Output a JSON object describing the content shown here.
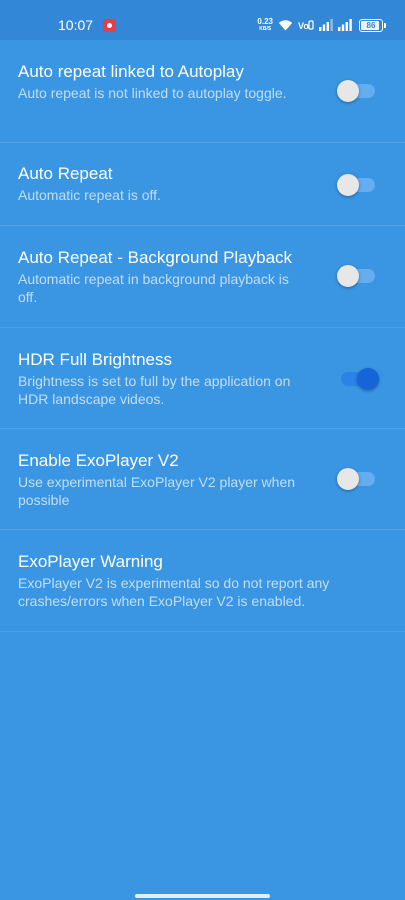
{
  "status_bar": {
    "time": "10:07",
    "net_speed": "0.23",
    "net_unit": "KB/S",
    "battery": "86"
  },
  "settings": [
    {
      "title": "Auto repeat linked to Autoplay",
      "summary": "Auto repeat is not linked to autoplay toggle.",
      "toggle": false
    },
    {
      "title": "Auto Repeat",
      "summary": "Automatic repeat is off.",
      "toggle": false
    },
    {
      "title": "Auto Repeat - Background Playback",
      "summary": "Automatic repeat in background playback is off.",
      "toggle": false
    },
    {
      "title": "HDR Full Brightness",
      "summary": "Brightness is set to full by the application on HDR landscape videos.",
      "toggle": true
    },
    {
      "title": "Enable ExoPlayer V2",
      "summary": "Use experimental ExoPlayer V2 player when possible",
      "toggle": false
    },
    {
      "title": "ExoPlayer Warning",
      "summary": "ExoPlayer V2 is experimental so do not report any crashes/errors when ExoPlayer V2 is enabled."
    }
  ],
  "colors": {
    "background": "#3a96e2",
    "status_bar": "#3287d6",
    "toggle_on": "#1565d8",
    "toggle_off_knob": "#e7e7e7"
  }
}
